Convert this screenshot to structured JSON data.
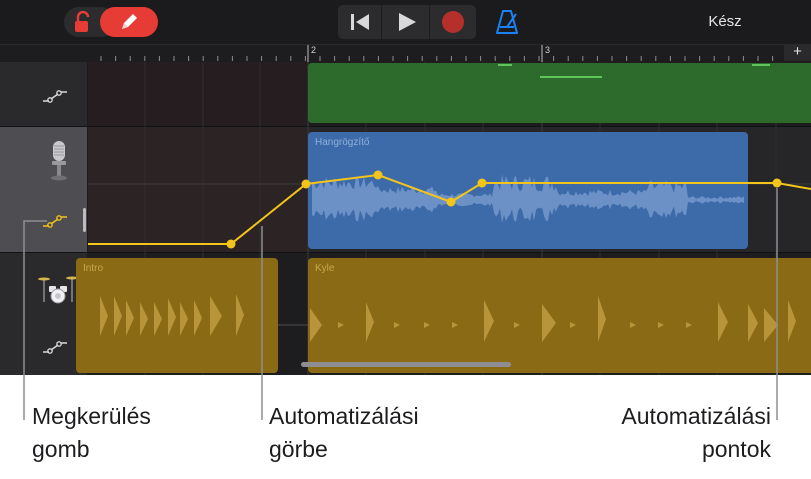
{
  "toolbar": {
    "lock_icon": "unlocked-padlock-icon",
    "pencil_icon": "pencil-icon",
    "transport": {
      "go_to_start_icon": "skip-back-icon",
      "play_icon": "play-icon",
      "record_icon": "record-icon"
    },
    "metronome_icon": "metronome-icon",
    "done_label": "Kész",
    "colors": {
      "pencil_active": "#e73c35",
      "lock": "#e73c35",
      "record": "#d13a32",
      "metronome": "#1a82f7"
    }
  },
  "ruler": {
    "bar_labels": [
      "2",
      "3"
    ],
    "add_section_label": "+"
  },
  "tracks": [
    {
      "id": "track-1",
      "icon": "automation-bypass-icon",
      "active": false,
      "color": "#2c6b2c"
    },
    {
      "id": "track-2",
      "icon": "microphone-icon",
      "automation_icon": "automation-bypass-icon",
      "active": true,
      "selected": true,
      "color": "#3d6aa8"
    },
    {
      "id": "track-3",
      "icon": "drum-kit-icon",
      "automation_icon": "automation-bypass-icon",
      "active": false,
      "color": "#8a6a14"
    }
  ],
  "regions": {
    "audio": {
      "name": "Hangrögzítő"
    },
    "drums_left": {
      "name": "Intro"
    },
    "drums_right": {
      "name": "Kyle"
    }
  },
  "automation": {
    "color": "#f3c41a",
    "point_count": 6
  },
  "callouts": {
    "bypass": {
      "line1": "Megkerülés",
      "line2": "gomb"
    },
    "curve": {
      "line1": "Automatizálási",
      "line2": "görbe"
    },
    "points": {
      "line1": "Automatizálási",
      "line2": "pontok"
    }
  }
}
